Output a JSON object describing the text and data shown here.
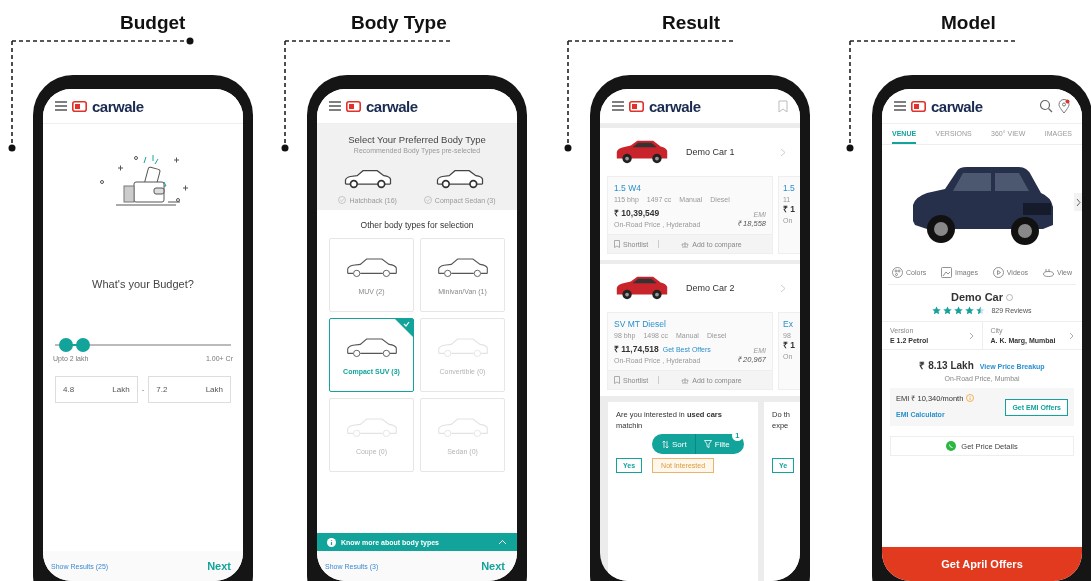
{
  "sections": [
    {
      "label": "Budget"
    },
    {
      "label": "Body Type"
    },
    {
      "label": "Result"
    },
    {
      "label": "Model"
    }
  ],
  "budget_screen": {
    "logo": "carwale",
    "question": "What's your Budget?",
    "slider": {
      "thumbs": [
        {
          "level": 0.06
        },
        {
          "level": 0.16
        }
      ],
      "min_label": "Upto 2 lakh",
      "max_label": "1.00+ Cr"
    },
    "fields": [
      {
        "value": "4.8",
        "unit": "Lakh"
      },
      {
        "value": "7.2",
        "unit": "Lakh"
      }
    ],
    "separator": "-",
    "show_results": "Show Results (25)",
    "next": "Next"
  },
  "body_type_screen": {
    "logo": "carwale",
    "title": "Select Your Preferred Body Type",
    "subtitle": "Recommended Body Types pre-selected",
    "recommended": [
      {
        "label": "Hatchback (16)"
      },
      {
        "label": "Compact Sedan (3)"
      }
    ],
    "other_heading": "Other body types for selection",
    "options": [
      {
        "label": "MUV (2)",
        "selected": false,
        "disabled": false
      },
      {
        "label": "Minivan/Van (1)",
        "selected": false,
        "disabled": false
      },
      {
        "label": "Compact SUV (3)",
        "selected": true,
        "disabled": false
      },
      {
        "label": "Convertible (0)",
        "selected": false,
        "disabled": true
      },
      {
        "label": "Coupe (0)",
        "selected": false,
        "disabled": true
      },
      {
        "label": "Sedan (0)",
        "selected": false,
        "disabled": true
      }
    ],
    "info": "Know more about body types",
    "show_results": "Show Results (3)",
    "next": "Next"
  },
  "result_screen": {
    "logo": "carwale",
    "cars": [
      {
        "name": "Demo Car 1",
        "version": {
          "title": "1.5 W4",
          "specs": [
            "115 bhp",
            "1497 cc",
            "Manual",
            "Diesel"
          ],
          "price": "₹ 10,39,549",
          "price_note": "On-Road Price , Hyderabad",
          "emi_label": "EMI",
          "emi": "₹ 18,558",
          "shortlist": "Shortlist",
          "compare": "Add to compare"
        },
        "peek": {
          "title": "1.5",
          "spec": "11",
          "price": "₹ 1",
          "note": "On"
        }
      },
      {
        "name": "Demo Car 2",
        "version": {
          "title": "SV MT Diesel",
          "specs": [
            "98 bhp",
            "1498 cc",
            "Manual",
            "Diesel"
          ],
          "price": "₹ 11,74,518",
          "offer": "Get Best Offers",
          "price_note": "On-Road Price , Hyderabad",
          "emi_label": "EMI",
          "emi": "₹ 20,967",
          "shortlist": "Shortlist",
          "compare": "Add to compare"
        },
        "peek": {
          "title": "Ex",
          "spec": "98",
          "price": "₹ 1",
          "note": "On"
        }
      }
    ],
    "prompts": [
      {
        "text": "Are you interested in **used cars** matchin",
        "yes": "Yes",
        "no": "Not Interested"
      },
      {
        "text": "Do th expe",
        "yes": "Ye"
      }
    ],
    "floating": {
      "sort": "Sort",
      "filter": "Filte",
      "badge": "1"
    }
  },
  "model_screen": {
    "logo": "carwale",
    "tabs": [
      {
        "label": "VENUE",
        "selected": true
      },
      {
        "label": "VERSIONS",
        "selected": false
      },
      {
        "label": "360° VIEW",
        "selected": false
      },
      {
        "label": "IMAGES",
        "selected": false
      }
    ],
    "media": [
      {
        "kind": "colors",
        "label": "Colors"
      },
      {
        "kind": "images",
        "label": "Images"
      },
      {
        "kind": "videos",
        "label": "Videos"
      },
      {
        "kind": "view360",
        "label": "View"
      }
    ],
    "name": "Demo Car",
    "rating": {
      "stars": 4.5,
      "reviews": "829 Reviews"
    },
    "version_label": "Version",
    "version": "E 1.2 Petrol",
    "city_label": "City",
    "city": "A. K. Marg, Mumbai",
    "price": "₹ 8.13 Lakh",
    "breakup": "View Price Breakup",
    "price_note": "On-Road Price, Mumbai",
    "emi": "EMI ₹ 10,340/month",
    "emi_calculator": "EMI Calculator",
    "emi_offers": "Get EMI Offers",
    "price_details": "Get Price Details",
    "cta": "Get April Offers"
  }
}
